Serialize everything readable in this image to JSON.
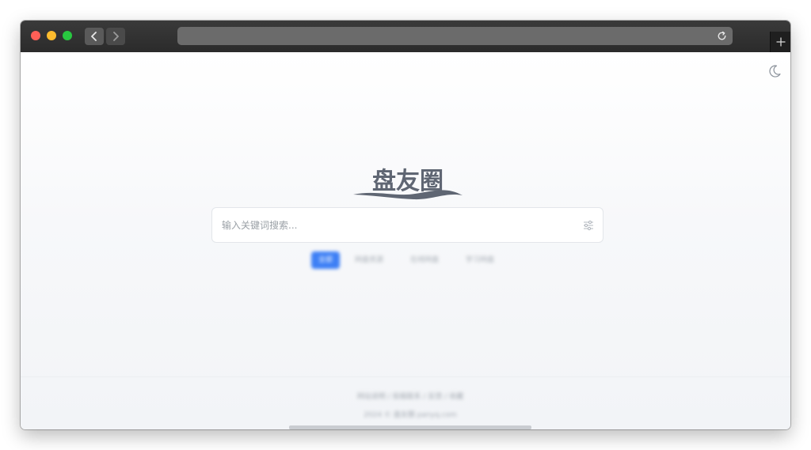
{
  "browser": {
    "address_text": ""
  },
  "page": {
    "logo_text": "盘友圈",
    "search": {
      "placeholder": "输入关键词搜索..."
    },
    "tabs": [
      {
        "label": "全部",
        "active": true
      },
      {
        "label": "网盘资源",
        "active": false
      },
      {
        "label": "在线网盘",
        "active": false
      },
      {
        "label": "学习网盘",
        "active": false
      }
    ],
    "footer": {
      "links": "网站说明 / 投稿联系 / 反馈 / 收藏",
      "copyright": "2024 © 盘友圈 panyq.com"
    }
  },
  "colors": {
    "accent": "#3d7ff5",
    "logo": "#5f6673"
  }
}
